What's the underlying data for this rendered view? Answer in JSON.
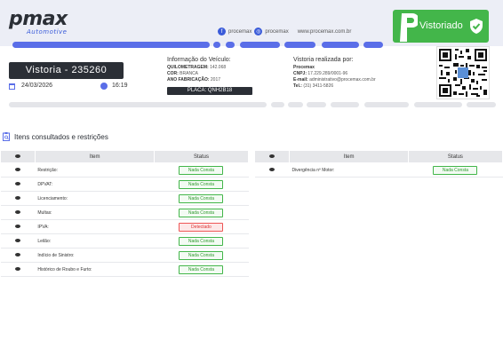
{
  "header": {
    "logo": {
      "main": "pmax",
      "sub": "Automotive"
    },
    "social": {
      "facebook": "procemax",
      "instagram": "procemax",
      "website": "www.procemax.com.br"
    },
    "badge_label": "Vistoriado"
  },
  "vistoria": {
    "title": "Vistoria - 235260",
    "date": "24/03/2026",
    "time": "16:19"
  },
  "vehicle": {
    "heading": "Informação do Veículo:",
    "fields": [
      {
        "label": "QUILOMETRAGEM:",
        "value": "142.068"
      },
      {
        "label": "COR:",
        "value": "BRANCA"
      },
      {
        "label": "ANO FABRICAÇÃO:",
        "value": "2017"
      }
    ],
    "plate": "PLACA: QNH2B18"
  },
  "inspector": {
    "heading": "Vistoria realizada por:",
    "name": "Procemax",
    "cnpj_label": "CNPJ:",
    "cnpj": "17.229.289/0001-96",
    "email_label": "E-mail:",
    "email": "administrativo@procemax.com.br",
    "tel_label": "Tel.:",
    "tel": "(31) 3411-5826"
  },
  "section": {
    "title": "Itens consultados e restrições"
  },
  "table": {
    "col_item": "Item",
    "col_status": "Status",
    "left_rows": [
      {
        "item": "Restrição:",
        "status": "Nada Consta",
        "state": "ok"
      },
      {
        "item": "DPVAT:",
        "status": "Nada Consta",
        "state": "ok"
      },
      {
        "item": "Licenciamento:",
        "status": "Nada Consta",
        "state": "ok"
      },
      {
        "item": "Multas:",
        "status": "Nada Consta",
        "state": "ok"
      },
      {
        "item": "IPVA:",
        "status": "Detectado",
        "state": "bad"
      },
      {
        "item": "Leilão:",
        "status": "Nada Consta",
        "state": "ok"
      },
      {
        "item": "Indício de Sinistro:",
        "status": "Nada Consta",
        "state": "ok"
      },
      {
        "item": "Histórico de Roubo e Furto:",
        "status": "Nada Consta",
        "state": "ok"
      }
    ],
    "right_rows": [
      {
        "item": "Divergência nº Motor:",
        "status": "Nada Consta",
        "state": "ok"
      }
    ]
  },
  "colors": {
    "accent": "#5a6ee8",
    "dark": "#2b2f36",
    "ok": "#43b64a",
    "bad": "#dd3333"
  }
}
